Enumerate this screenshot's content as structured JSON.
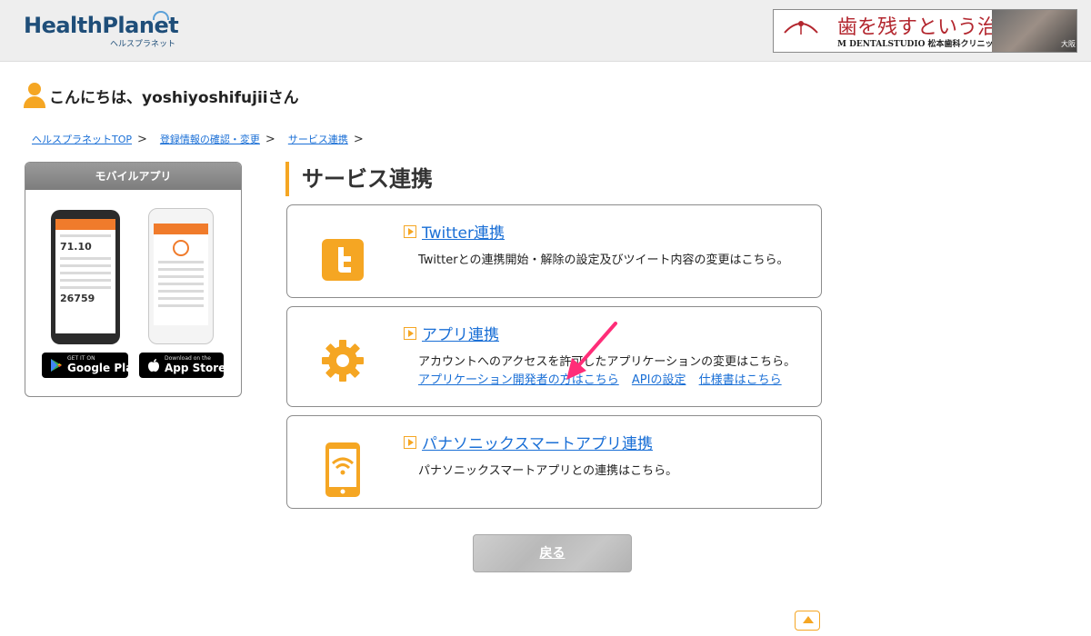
{
  "header": {
    "logo_main": "HealthPlanet",
    "logo_sub": "ヘルスプラネット",
    "ad": {
      "mark_text": "M DENTAL STUDIO",
      "title": "歯を残すという治療",
      "sub": "M DENTALSTUDIO 松本歯科クリニック",
      "photo_caption": "大阪"
    }
  },
  "greeting": "こんにちは、yoshiyoshifujiiさん",
  "breadcrumb": {
    "items": [
      "ヘルスプラネットTOP",
      "登録情報の確認・変更",
      "サービス連携"
    ],
    "separator": ">"
  },
  "sidebar": {
    "title": "モバイルアプリ",
    "phone_value_1": "71.10",
    "phone_value_2": "26759",
    "google_play": {
      "small": "GET IT ON",
      "big": "Google Play"
    },
    "app_store": {
      "small": "Download on the",
      "big": "App Store"
    }
  },
  "main": {
    "title": "サービス連携",
    "cards": [
      {
        "link": "Twitter連携",
        "desc": "Twitterとの連携開始・解除の設定及びツイート内容の変更はこちら。",
        "icon": "twitter-icon"
      },
      {
        "link": "アプリ連携",
        "desc": "アカウントへのアクセスを許可したアプリケーションの変更はこちら。",
        "sub_links": [
          "アプリケーション開発者の方はこちら",
          "APIの設定",
          "仕様書はこちら"
        ],
        "icon": "gear-icon"
      },
      {
        "link": "パナソニックスマートアプリ連携",
        "desc": "パナソニックスマートアプリとの連携はこちら。",
        "icon": "smartphone-wifi-icon"
      }
    ],
    "back_label": "戻る"
  },
  "colors": {
    "accent": "#f5a623",
    "link": "#1a6fd6",
    "annotation_arrow": "#ff2d78"
  }
}
